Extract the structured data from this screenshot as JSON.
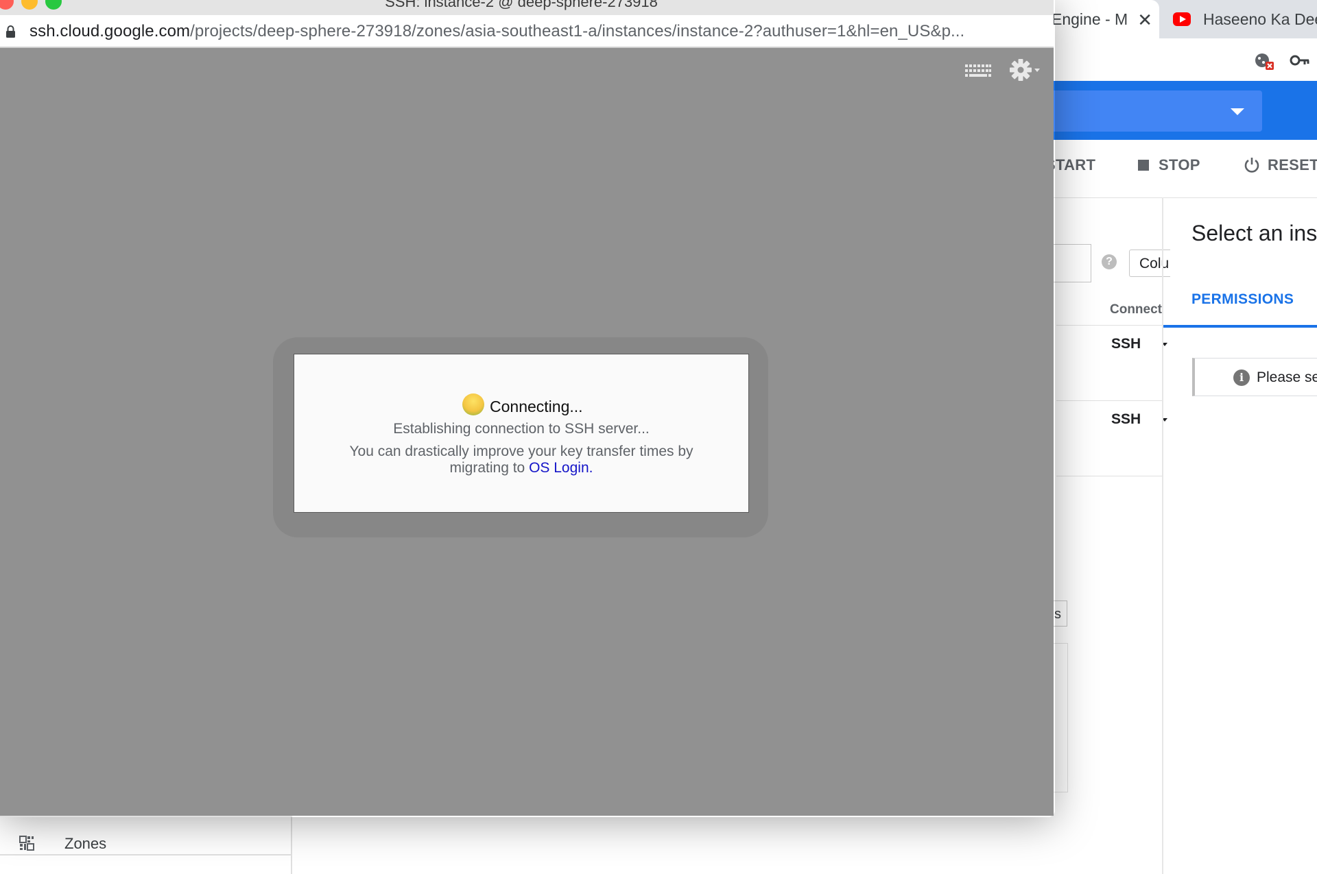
{
  "background_browser": {
    "tabs": [
      {
        "label": "Engine - M",
        "close": "✕"
      },
      {
        "label": "Haseeno Ka Dee"
      }
    ],
    "actions": {
      "start": "START",
      "stop": "STOP",
      "reset": "RESET"
    },
    "filter_help": "?",
    "columns_button": "Colu",
    "table": {
      "connect_header": "Connect",
      "rows": [
        {
          "connect": "SSH"
        },
        {
          "connect": "SSH"
        }
      ]
    },
    "side_panel": {
      "title": "Select an inst",
      "tab": "PERMISSIONS",
      "info_icon": "i",
      "info_text": "Please se"
    },
    "small_button": "s",
    "nav": {
      "zones": "Zones"
    },
    "accent_color": "#1a73e8"
  },
  "ssh_window": {
    "title": "SSH: instance-2 @ deep-sphere-273918",
    "url": {
      "host": "ssh.cloud.google.com",
      "path": "/projects/deep-sphere-273918/zones/asia-southeast1-a/instances/instance-2?authuser=1&hl=en_US&p..."
    },
    "toolbar": {
      "keyboard_icon": "keyboard-icon",
      "settings_icon": "gear-icon"
    },
    "dialog": {
      "status": "Connecting...",
      "message": "Establishing connection to SSH server...",
      "hint_line1": "You can drastically improve your key transfer times by",
      "hint_line2_prefix": "migrating to",
      "link_text": "OS Login."
    }
  }
}
